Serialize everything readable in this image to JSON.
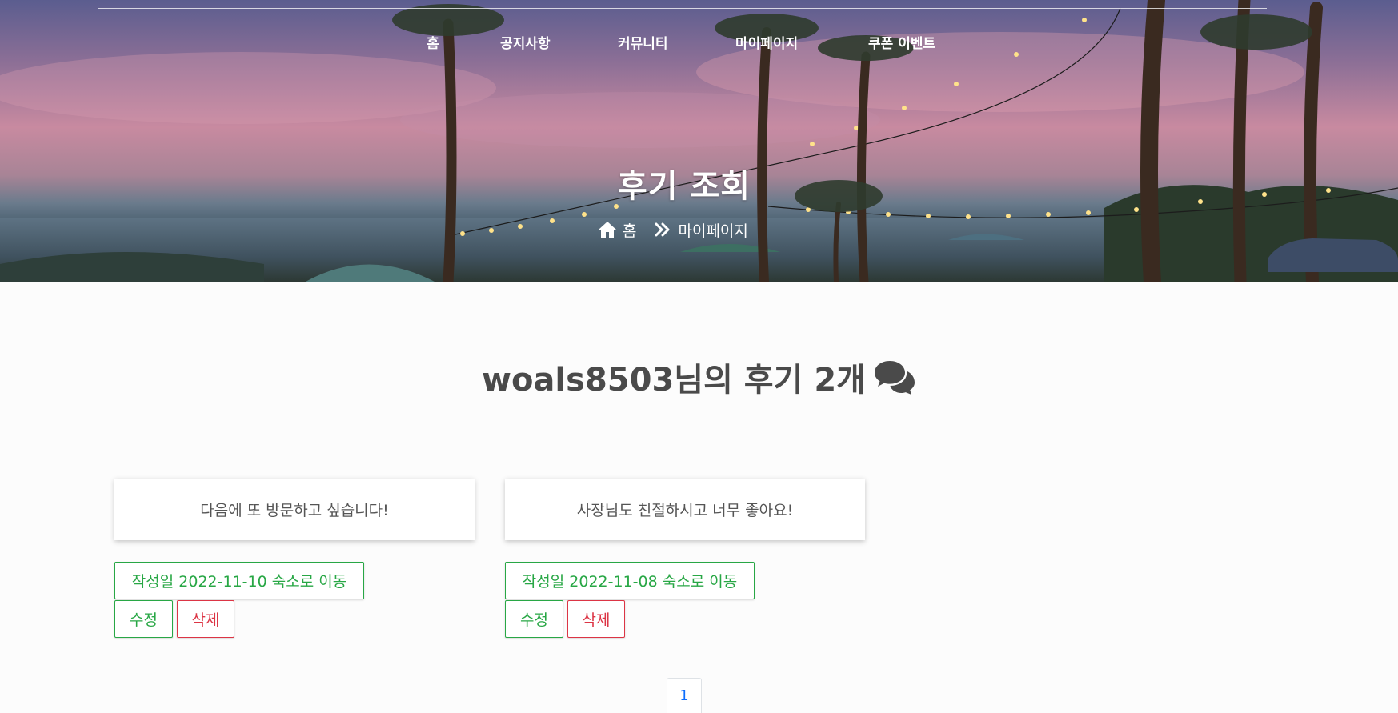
{
  "nav": {
    "items": [
      {
        "label": "홈"
      },
      {
        "label": "공지사항"
      },
      {
        "label": "커뮤니티"
      },
      {
        "label": "마이페이지"
      },
      {
        "label": "쿠폰 이벤트"
      }
    ]
  },
  "hero": {
    "title": "후기 조회",
    "breadcrumb_home": "홈",
    "breadcrumb_current": "마이페이지",
    "home_icon": "home-icon",
    "separator_icon": "double-chevron-right-icon"
  },
  "main": {
    "title": "woals8503님의 후기 2개",
    "title_icon": "comments-icon"
  },
  "reviews": [
    {
      "text": "다음에 또 방문하고 싶습니다!",
      "info_button": "작성일 2022-11-10 숙소로 이동",
      "edit_label": "수정",
      "delete_label": "삭제"
    },
    {
      "text": "사장님도 친절하시고 너무 좋아요!",
      "info_button": "작성일 2022-11-08 숙소로 이동",
      "edit_label": "수정",
      "delete_label": "삭제"
    }
  ],
  "pagination": {
    "current": "1"
  },
  "colors": {
    "accent_green": "#28a745",
    "accent_red": "#dc3545",
    "link_blue": "#0d6efd"
  }
}
